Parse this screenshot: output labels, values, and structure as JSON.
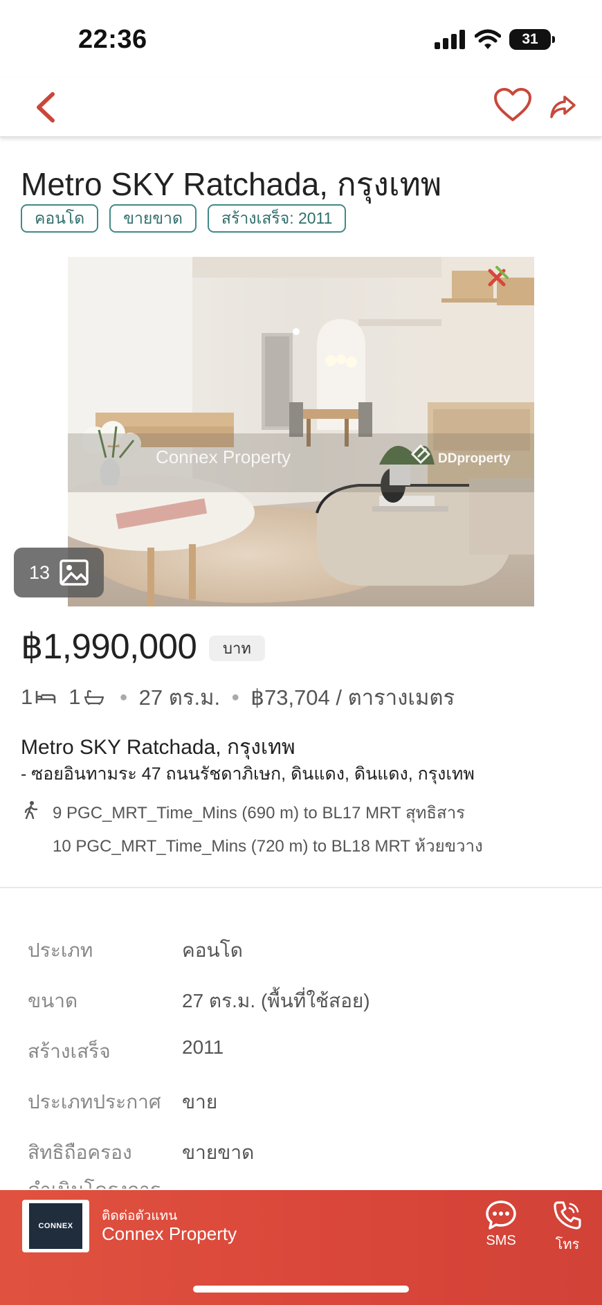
{
  "status_bar": {
    "time": "22:36",
    "battery": "31"
  },
  "listing": {
    "title": "Metro SKY Ratchada, กรุงเทพ",
    "chips": [
      "คอนโด",
      "ขายขาด",
      "สร้างเสร็จ: 2011"
    ],
    "photo_count": "13",
    "photo_watermarks": {
      "left": "Connex Property",
      "right": "DDproperty"
    },
    "price": "฿1,990,000",
    "currency": "บาท",
    "bedrooms": "1",
    "bathrooms": "1",
    "area": "27 ตร.ม.",
    "price_per_sqm": "฿73,704 / ตารางเมตร",
    "location_name": "Metro SKY Ratchada, กรุงเทพ",
    "address": "- ซอยอินทามระ 47 ถนนรัชดาภิเษก, ดินแดง, ดินแดง, กรุงเทพ",
    "transit": [
      "9 PGC_MRT_Time_Mins (690 m) to BL17 MRT สุทธิสาร",
      "10 PGC_MRT_Time_Mins (720 m) to BL18 MRT ห้วยขวาง"
    ]
  },
  "details": [
    {
      "label": "ประเภท",
      "value": "คอนโด"
    },
    {
      "label": "ขนาด",
      "value": "27 ตร.ม. (พื้นที่ใช้สอย)"
    },
    {
      "label": "สร้างเสร็จ",
      "value": "2011"
    },
    {
      "label": "ประเภทประกาศ",
      "value": "ขาย"
    },
    {
      "label": "สิทธิถือครอง",
      "value": "ขายขาด"
    },
    {
      "label": "ดำเนินโครงการ",
      "value": ""
    }
  ],
  "footer": {
    "agent_label": "ติดต่อตัวแทน",
    "agent_name": "Connex Property",
    "agent_logo_text": "CONNEX",
    "sms_label": "SMS",
    "call_label": "โทร"
  },
  "colors": {
    "accent": "#d9463a",
    "chip": "#3e8a86",
    "nav_icon": "#c8473b"
  },
  "icons": [
    "back-icon",
    "heart-icon",
    "share-icon",
    "gallery-icon",
    "bed-icon",
    "bath-icon",
    "walk-icon",
    "sms-icon",
    "phone-icon"
  ]
}
